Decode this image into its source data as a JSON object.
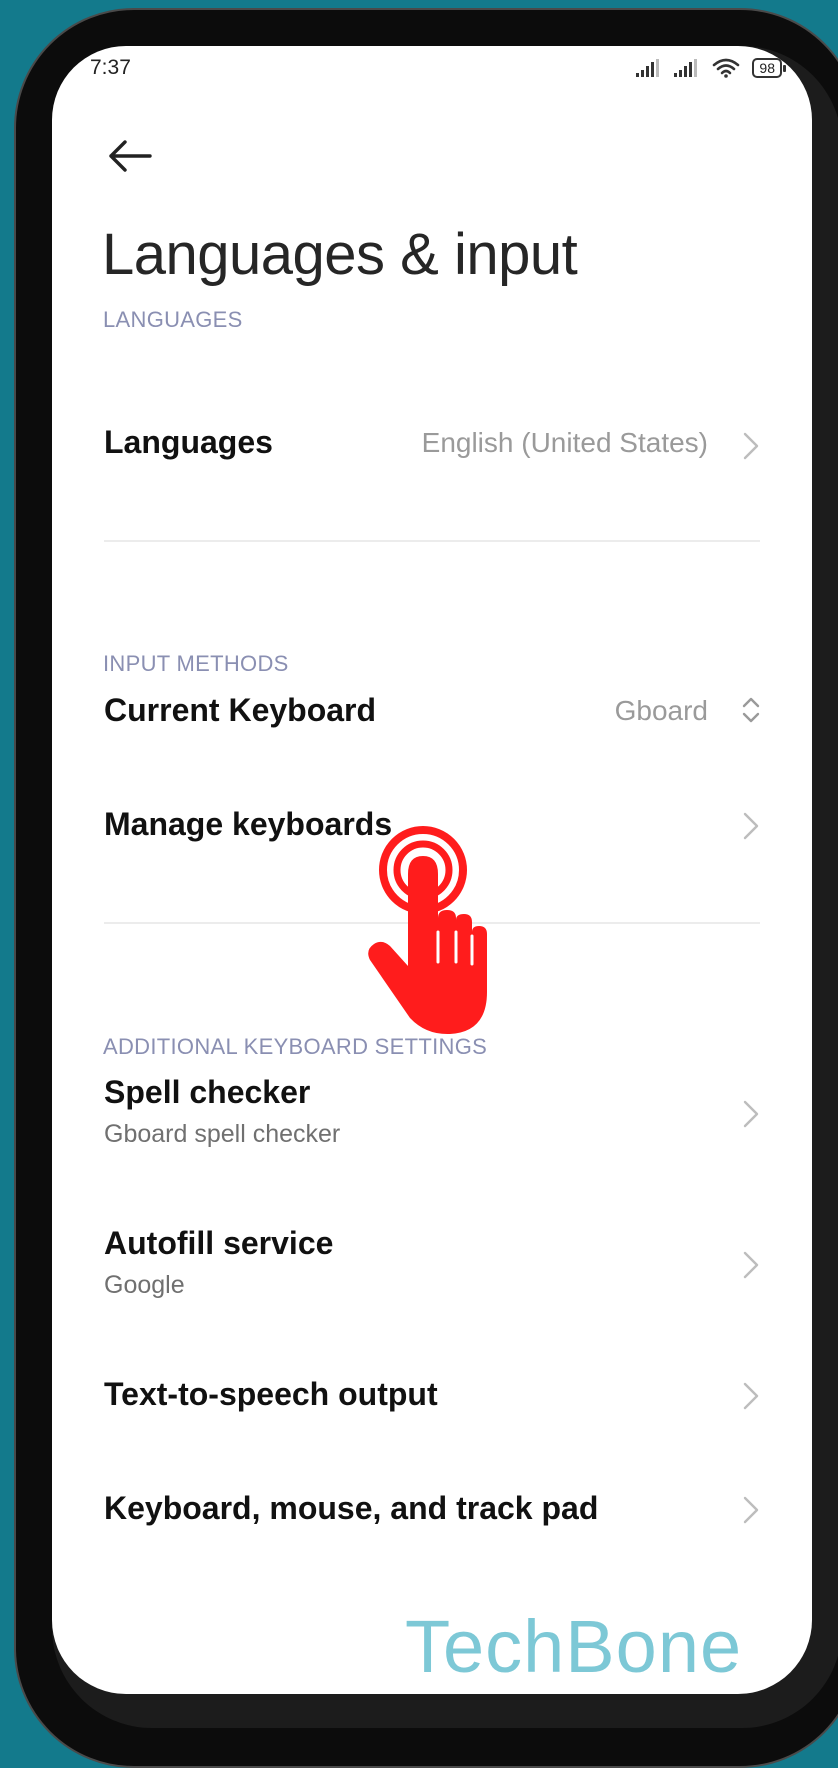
{
  "status_bar": {
    "time": "7:37",
    "battery": "98",
    "icons": [
      "signal-icon",
      "signal-icon",
      "wifi-icon",
      "battery-icon"
    ]
  },
  "header": {
    "back_icon": "arrow-left-icon",
    "title": "Languages & input"
  },
  "sections": {
    "languages": {
      "header": "LANGUAGES",
      "languages_row": {
        "title": "Languages",
        "value": "English (United States)"
      }
    },
    "input_methods": {
      "header": "INPUT METHODS",
      "current_keyboard": {
        "title": "Current Keyboard",
        "value": "Gboard"
      },
      "manage_keyboards": {
        "title": "Manage keyboards"
      }
    },
    "additional": {
      "header": "ADDITIONAL KEYBOARD SETTINGS",
      "spell_checker": {
        "title": "Spell checker",
        "subtitle": "Gboard spell checker"
      },
      "autofill": {
        "title": "Autofill service",
        "subtitle": "Google"
      },
      "tts": {
        "title": "Text-to-speech output"
      },
      "keyboard_mouse": {
        "title": "Keyboard, mouse, and track pad"
      }
    }
  },
  "overlay": {
    "tap_icon": "tap-hand-icon",
    "tap_color": "#ff1c1c",
    "watermark": "TechBone",
    "watermark_color": "#7dc8d6"
  },
  "colors": {
    "background": "#137a8c",
    "section_header": "#8a8fb2"
  }
}
